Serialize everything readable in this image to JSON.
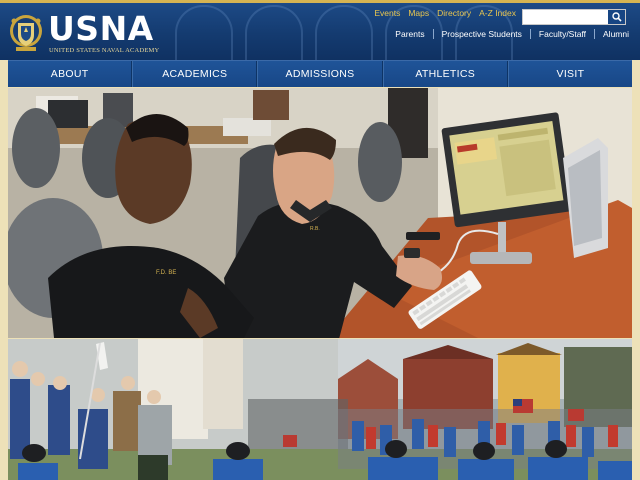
{
  "site": {
    "logo_text": "USNA",
    "logo_subtitle": "UNITED STATES NAVAL ACADEMY"
  },
  "utility_links": [
    "Events",
    "Maps",
    "Directory",
    "A-Z Index"
  ],
  "search": {
    "placeholder": "",
    "value": ""
  },
  "audience_links": [
    "Parents",
    "Prospective Students",
    "Faculty/Staff",
    "Alumni"
  ],
  "nav": [
    "ABOUT",
    "ACADEMICS",
    "ADMISSIONS",
    "ATHLETICS",
    "VISIT"
  ],
  "hero": {
    "nametag_left": "F.D. BE",
    "nametag_right": "R.B."
  },
  "colors": {
    "navy": "#143b70",
    "nav_blue": "#1f5498",
    "gold": "#e9c64f",
    "frame_gold": "#ede1b8"
  },
  "icons": {
    "search": "search-icon",
    "crest": "naval-crest-icon"
  }
}
